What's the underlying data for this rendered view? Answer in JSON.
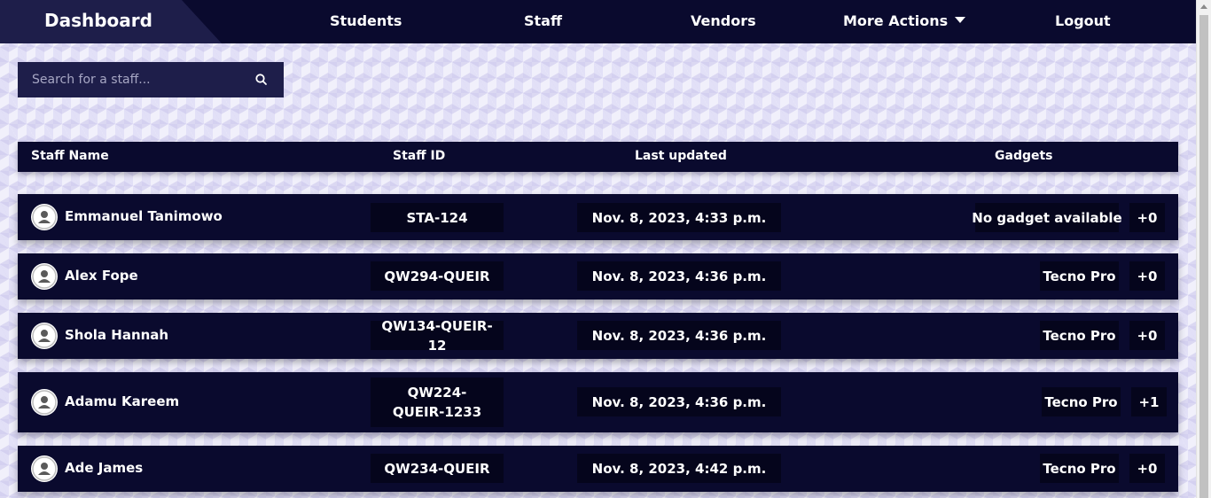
{
  "nav": {
    "brand": "Dashboard",
    "items": [
      "Students",
      "Staff",
      "Vendors",
      "More Actions",
      "Logout"
    ]
  },
  "search": {
    "placeholder": "Search for a staff..."
  },
  "table": {
    "headers": [
      "Staff Name",
      "Staff ID",
      "Last updated",
      "Gadgets"
    ],
    "rows": [
      {
        "name": "Emmanuel Tanimowo",
        "staff_id": "STA-124",
        "last_updated": "Nov. 8, 2023, 4:33 p.m.",
        "gadget": "No gadget available",
        "count": "+0"
      },
      {
        "name": "Alex Fope",
        "staff_id": "QW294-QUEIR",
        "last_updated": "Nov. 8, 2023, 4:36 p.m.",
        "gadget": "Tecno Pro",
        "count": "+0"
      },
      {
        "name": "Shola Hannah",
        "staff_id": "QW134-QUEIR-12",
        "last_updated": "Nov. 8, 2023, 4:36 p.m.",
        "gadget": "Tecno Pro",
        "count": "+0"
      },
      {
        "name": "Adamu Kareem",
        "staff_id": "QW224-QUEIR-1233",
        "last_updated": "Nov. 8, 2023, 4:36 p.m.",
        "gadget": "Tecno Pro",
        "count": "+1"
      },
      {
        "name": "Ade James",
        "staff_id": "QW234-QUEIR",
        "last_updated": "Nov. 8, 2023, 4:42 p.m.",
        "gadget": "Tecno Pro",
        "count": "+0"
      }
    ]
  },
  "colors": {
    "navy": "#0a0a2e",
    "brand_tab": "#1e1e4a",
    "cell_bg": "#05051c"
  },
  "icons": {
    "search": "search-icon",
    "avatar": "user-avatar-icon",
    "dropdown": "caret-down-icon"
  }
}
